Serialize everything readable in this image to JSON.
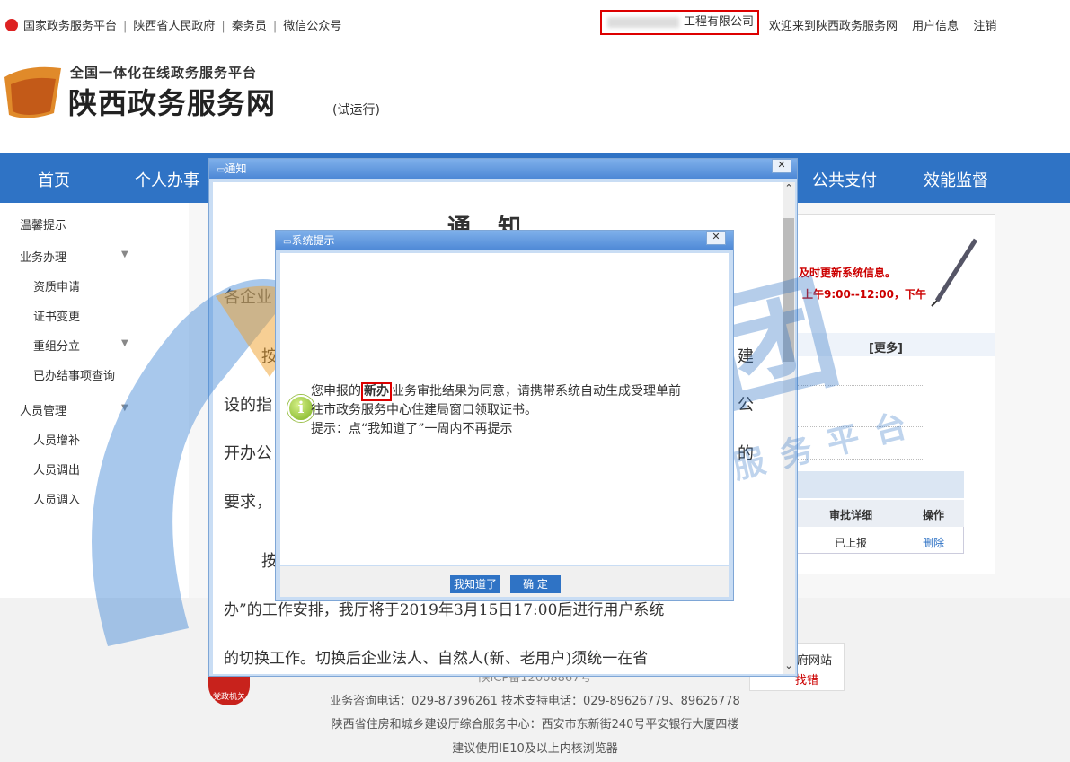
{
  "topbar": {
    "links": [
      "国家政务服务平台",
      "陕西省人民政府",
      "秦务员",
      "微信公众号"
    ],
    "company": "工程有限公司",
    "welcome": "欢迎来到陕西政务服务网",
    "user_info": "用户信息",
    "logout": "注销"
  },
  "header": {
    "subtitle": "全国一体化在线政务服务平台",
    "title": "陕西政务服务网",
    "trial": "(试运行)"
  },
  "nav": {
    "items": [
      "首页",
      "个人办事",
      "公共支付",
      "效能监督"
    ]
  },
  "sidebar": {
    "items": [
      "温馨提示",
      "业务办理",
      "资质申请",
      "证书变更",
      "重组分立",
      "已办结事项查询",
      "人员管理",
      "人员增补",
      "人员调出",
      "人员调入"
    ]
  },
  "rightpanel": {
    "notice1": "及时更新系统信息。",
    "notice2": "上午9:00--12:00，下午",
    "more": "[更多]",
    "col_approval": "审批详细",
    "col_action": "操作",
    "row_status": "已上报",
    "row_action": "删除"
  },
  "footer": {
    "icp": "陕ICP备12008867号",
    "tel": "业务咨询电话：029-87396261  技术支持电话：029-89626779、89626778",
    "addr": "陕西省住房和城乡建设厅综合服务中心：西安市东新街240号平安银行大厦四楼",
    "browser": "建议使用IE10及以上内核浏览器",
    "badge": "党政机关",
    "findbug1": "府网站",
    "findbug2": "找错"
  },
  "notice_window": {
    "title_bar": "通知",
    "heading": "通知",
    "p1": "各企业",
    "p2a": "按",
    "p2b": "建",
    "p3a": "设的指",
    "p3b": "公",
    "p4a": "开办公",
    "p4b": "的",
    "p5": "要求，",
    "p6": "按",
    "p7": "办”的工作安排，我厅将于2019年3月15日17:00后进行用户系统",
    "p8": "的切换工作。切换后企业法人、自然人(新、老用户)须统一在省"
  },
  "dialog": {
    "title_bar": "系统提示",
    "msg1_pre": "您申报的",
    "msg1_hl": "新办",
    "msg1_post": "业务审批结果为同意，请携带系统自动生成受理单前",
    "msg2": "往市政务服务中心住建局窗口领取证书。",
    "msg3": "提示：点“我知道了”一周内不再提示",
    "btn_know": "我知道了",
    "btn_ok": "确 定"
  },
  "watermark": {
    "main": "帝朗集团",
    "sub": "建筑企业一站式服务平台"
  },
  "colors": {
    "nav_blue": "#2f73c5",
    "highlight_red": "#dd0000",
    "notice_red": "#cc0000"
  }
}
